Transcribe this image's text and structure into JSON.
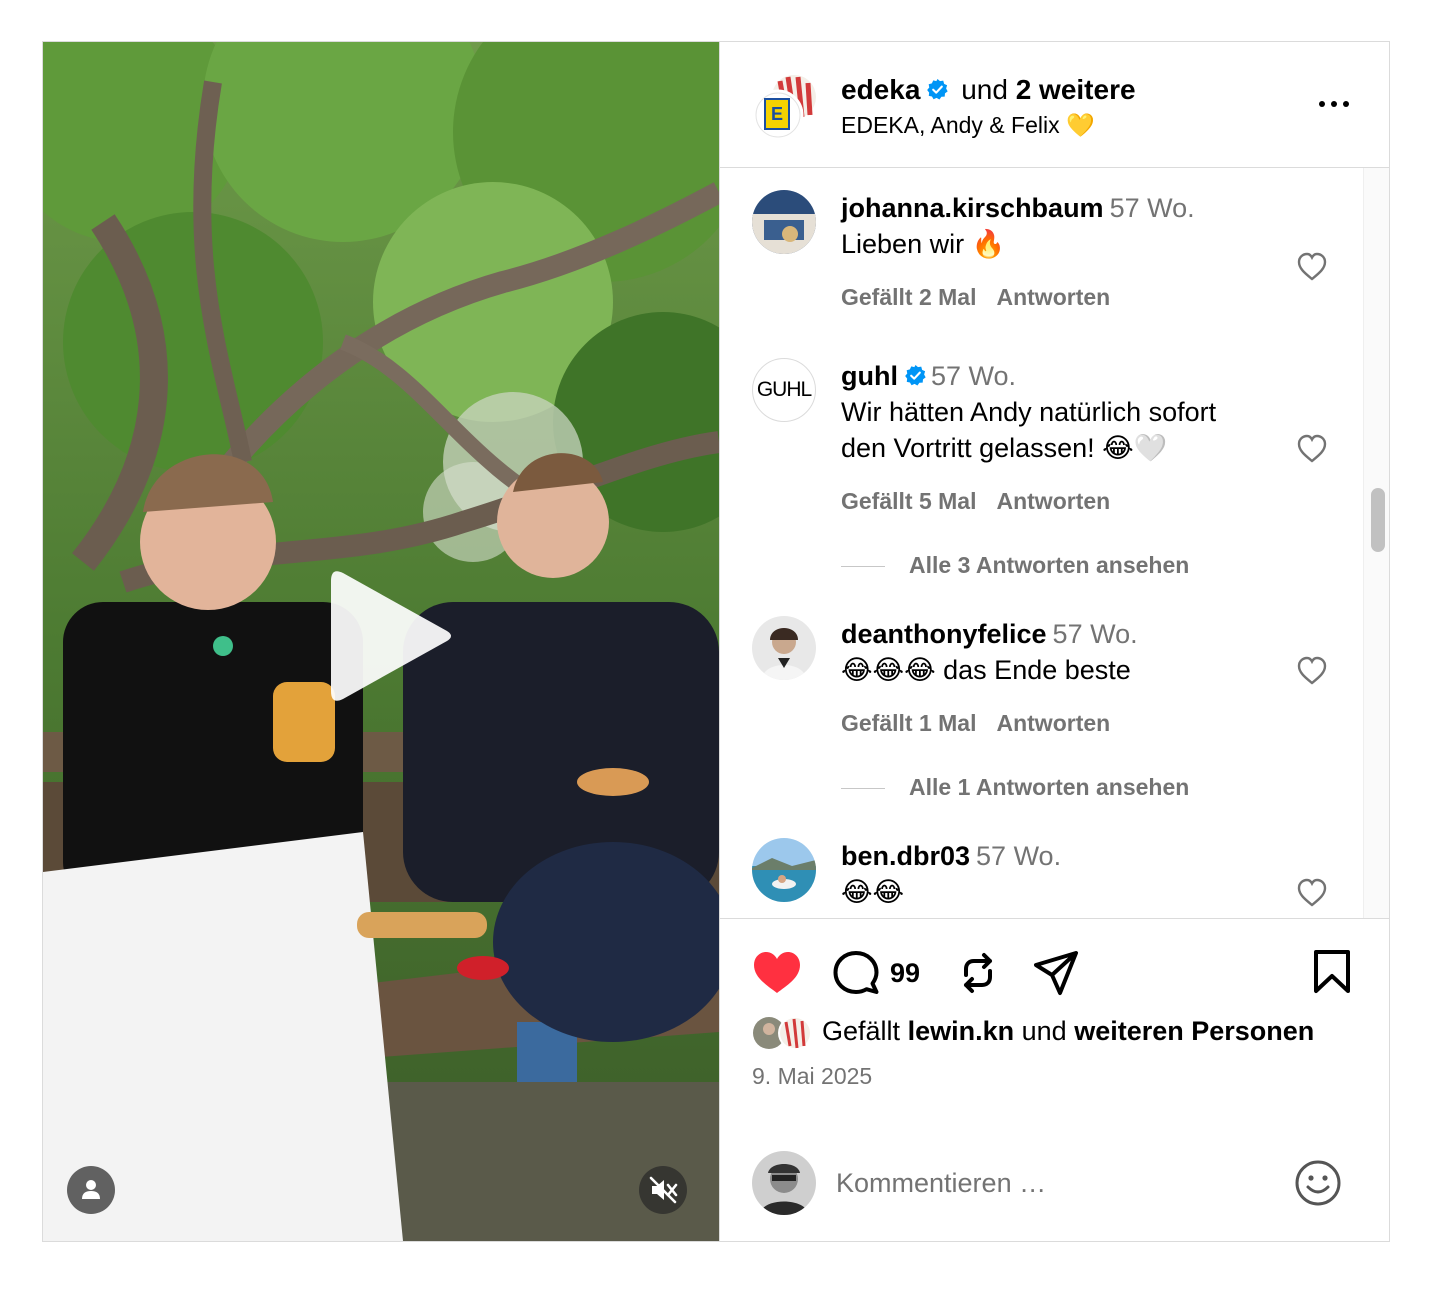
{
  "header": {
    "account": "edeka",
    "and_label": "und",
    "others": "2 weitere",
    "subtitle": "EDEKA, Andy & Felix 💛",
    "more_icon": "more-horizontal-icon"
  },
  "comments": [
    {
      "user": "johanna.kirschbaum",
      "time": "57 Wo.",
      "text": "Lieben wir 🔥",
      "likes": "Gefällt 2 Mal",
      "reply": "Antworten"
    },
    {
      "user": "guhl",
      "verified": true,
      "time": "57 Wo.",
      "text": "Wir hätten Andy natürlich sofort den Vortritt gelassen! 😂🤍",
      "likes": "Gefällt 5 Mal",
      "reply": "Antworten",
      "view_replies": "Alle 3 Antworten ansehen"
    },
    {
      "user": "deanthonyfelice",
      "time": "57 Wo.",
      "text": "😂😂😂 das Ende beste",
      "likes": "Gefällt 1 Mal",
      "reply": "Antworten",
      "view_replies": "Alle 1 Antworten ansehen"
    },
    {
      "user": "ben.dbr03",
      "time": "57 Wo.",
      "text": "😂😂"
    }
  ],
  "guhl_avatar_text": "GUHL",
  "actions": {
    "liked": true,
    "comment_count": "99",
    "like_color": "#ff3040"
  },
  "likes_line": {
    "prefix": "Gefällt",
    "user": "lewin.kn",
    "middle": "und",
    "suffix": "weiteren Personen"
  },
  "date": "9. Mai 2025",
  "comment_input": {
    "placeholder": "Kommentieren …"
  },
  "colors": {
    "verified": "#0095f6",
    "muted_text": "#737373",
    "border": "#dbdbdb"
  }
}
